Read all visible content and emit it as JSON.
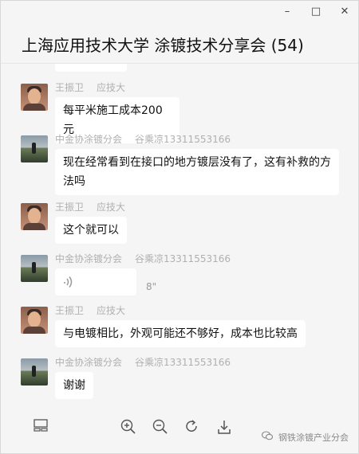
{
  "window": {
    "title": "上海应用技术大学 涂镀技术分享会  (54)",
    "controls": [
      "–",
      "□",
      "✕"
    ]
  },
  "messages": [
    {
      "sender": "王振卫",
      "org": "应技大",
      "avatar": "person-avatar",
      "text": "每平米施工成本200元"
    },
    {
      "sender": "中金协涂镀分会",
      "org": "谷乘凉13311553166",
      "avatar": "landscape-avatar",
      "text": "现在经常看到在接口的地方镀层没有了，这有补救的方法吗"
    },
    {
      "sender": "王振卫",
      "org": "应技大",
      "avatar": "person-avatar",
      "text": "这个就可以"
    },
    {
      "sender": "中金协涂镀分会",
      "org": "谷乘凉13311553166",
      "avatar": "landscape-avatar",
      "voice_duration": "8\""
    },
    {
      "sender": "王振卫",
      "org": "应技大",
      "avatar": "person-avatar",
      "text": "与电镀相比，外观可能还不够好，成本也比较高"
    },
    {
      "sender": "中金协涂镀分会",
      "org": "谷乘凉13311553166",
      "avatar": "landscape-avatar",
      "text": "谢谢"
    }
  ],
  "toolbar": {
    "icons": [
      "thumbnail-icon",
      "zoom-in-icon",
      "zoom-out-icon",
      "rotate-icon",
      "download-icon"
    ]
  },
  "watermark": {
    "text": "钢铁涂镀产业分会"
  }
}
